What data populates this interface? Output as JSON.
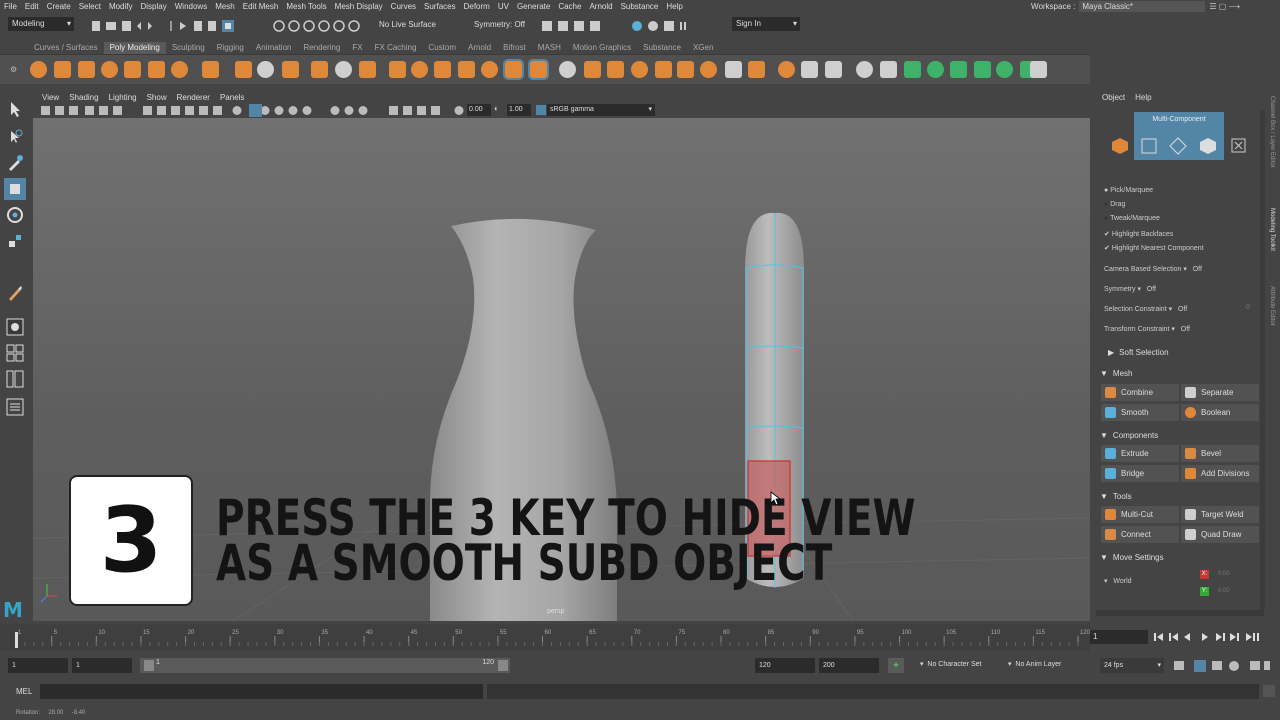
{
  "menubar": {
    "items": [
      "File",
      "Edit",
      "Create",
      "Select",
      "Modify",
      "Display",
      "Windows",
      "Mesh",
      "Edit Mesh",
      "Mesh Tools",
      "Mesh Display",
      "Curves",
      "Surfaces",
      "Deform",
      "UV",
      "Generate",
      "Cache",
      "Arnold",
      "Substance",
      "Help"
    ],
    "workspace_label": "Workspace :",
    "workspace_value": "Maya Classic*"
  },
  "statusline": {
    "mode": "Modeling",
    "live_surface": "No Live Surface",
    "symmetry": "Symmetry: Off",
    "sign_in": "Sign In"
  },
  "shelf": {
    "tabs": [
      "Curves / Surfaces",
      "Poly Modeling",
      "Sculpting",
      "Rigging",
      "Animation",
      "Rendering",
      "FX",
      "FX Caching",
      "Custom",
      "Arnold",
      "Bifrost",
      "MASH",
      "Motion Graphics",
      "Substance",
      "XGen"
    ],
    "active_tab": "Poly Modeling"
  },
  "viewport": {
    "menu": [
      "View",
      "Shading",
      "Lighting",
      "Show",
      "Renderer",
      "Panels"
    ],
    "field_a": "0.00",
    "field_b": "1.00",
    "color_space": "sRGB gamma",
    "camera_label": "persp"
  },
  "overlay": {
    "step_number": "3",
    "caption_line1": "PRESS THE 3 KEY TO HIDE VIEW",
    "caption_line2": "AS A SMOOTH SUBD OBJECT"
  },
  "modeling_toolkit": {
    "menu": [
      "Object",
      "Help"
    ],
    "mode_label": "Multi-Component",
    "options": [
      "Pick/Marquee",
      "Drag",
      "Tweak/Marquee",
      "Highlight Backfaces",
      "Highlight Nearest Component"
    ],
    "camera_based_selection": {
      "label": "Camera Based Selection",
      "value": "Off"
    },
    "symmetry": {
      "label": "Symmetry",
      "value": "Off"
    },
    "selection_constraint": {
      "label": "Selection Constraint",
      "value": "Off"
    },
    "transform_constraint": {
      "label": "Transform Constraint",
      "value": "Off"
    },
    "zero_value": "0",
    "soft_selection": "Soft Selection",
    "mesh_section": "Mesh",
    "mesh_buttons": [
      "Combine",
      "Separate",
      "Smooth",
      "Boolean"
    ],
    "components_section": "Components",
    "component_buttons": [
      "Extrude",
      "Bevel",
      "Bridge",
      "Add Divisions"
    ],
    "tools_section": "Tools",
    "tool_buttons": [
      "Multi-Cut",
      "Target Weld",
      "Connect",
      "Quad Draw"
    ],
    "move_settings_section": "Move Settings",
    "world_label": "World",
    "axis_labels": [
      "X:",
      "Y:"
    ],
    "axis_values": [
      "0.00",
      "0.00"
    ]
  },
  "side_tabs": [
    "Channel Box / Layer Editor",
    "Modeling Toolkit",
    "Attribute Editor"
  ],
  "timeline": {
    "ticks": [
      "1",
      "5",
      "10",
      "15",
      "20",
      "25",
      "30",
      "35",
      "40",
      "45",
      "50",
      "55",
      "60",
      "65",
      "70",
      "75",
      "80",
      "85",
      "90",
      "95",
      "100",
      "105",
      "110",
      "115",
      "120"
    ],
    "current_frame": "1"
  },
  "range": {
    "start": "1",
    "start_inner": "1",
    "slider_start": "1",
    "slider_end": "120",
    "end_inner": "120",
    "end": "200",
    "character_set": "No Character Set",
    "anim_layer": "No Anim Layer",
    "fps": "24 fps"
  },
  "command_line": {
    "label": "MEL"
  },
  "help_line": {
    "label": "Rotation:",
    "v1": "28.00",
    "v2": "-8.40"
  },
  "colors": {
    "accent": "#5285a6",
    "orange": "#e0883a",
    "panel": "#444444",
    "viewport": "#6b6b6b"
  }
}
